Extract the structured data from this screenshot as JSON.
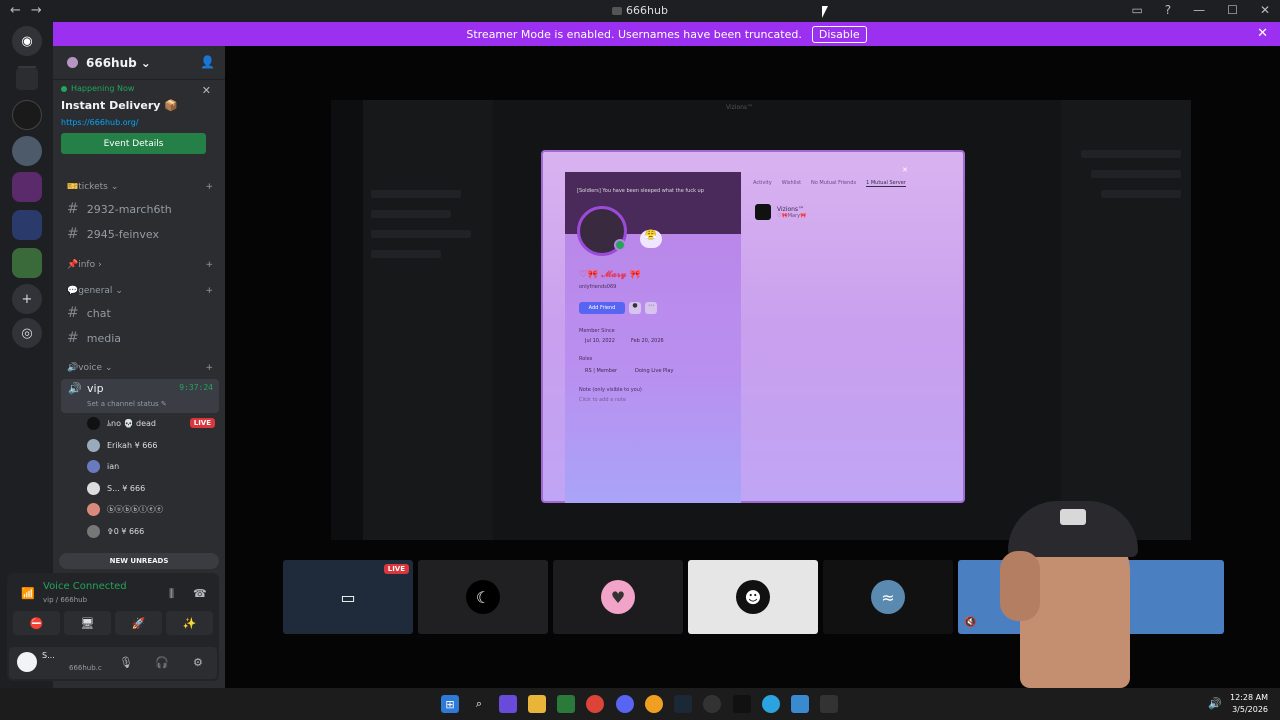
{
  "window": {
    "title": "666hub",
    "back_icon": "←",
    "forward_icon": "→",
    "inbox_icon": "▭",
    "help_icon": "?",
    "minimize": "—",
    "maximize": "☐",
    "close": "✕"
  },
  "banner": {
    "text": "Streamer Mode is enabled. Usernames have been truncated.",
    "button": "Disable",
    "close": "✕"
  },
  "server": {
    "name": "666hub",
    "chevron": "⌄"
  },
  "event": {
    "happening": "Happening Now",
    "title": "Instant Delivery 📦",
    "link": "https://666hub.org/",
    "button": "Event Details",
    "close": "✕"
  },
  "categories": {
    "tickets": "🎫tickets",
    "info": "📌info",
    "general": "💬general",
    "voice": "🔊voice",
    "plus": "+",
    "expand": "⌄",
    "collapsed": "›"
  },
  "channels": {
    "c1": "2932-march6th",
    "c2": "2945-feinvex",
    "c3": "chat",
    "c4": "media"
  },
  "voice_channel": {
    "name": "vip",
    "time": "9:37:24",
    "status": "Set a channel status ✎"
  },
  "voice_users": [
    {
      "name": "ﾑnо 💀 dead",
      "live": "LIVE"
    },
    {
      "name": "Erikah ¥ 666"
    },
    {
      "name": "ian"
    },
    {
      "name": "S... ¥ 666"
    },
    {
      "name": "ⓑⓤⓑⓑⓛⓔⓔ"
    },
    {
      "name": "✞0 ¥ 666"
    }
  ],
  "new_unreads": "NEW UNREADS",
  "voice_panel": {
    "title": "Voice Connected",
    "sub": "vip / 666hub",
    "sig_icon": "📶",
    "waveform_icon": "⫼",
    "hangup_icon": "☎",
    "btn1": "⛔",
    "btn2": "🖥",
    "btn3": "🚀",
    "btn4": "✨"
  },
  "user": {
    "name": "S...",
    "sub": "666hub.c",
    "mic": "🎙",
    "headphones": "🎧",
    "gear": "⚙"
  },
  "profile": {
    "note": "[Soldiers] You have been sleeped what the fuck up",
    "name": "♡🎀 𝓜𝓪𝓻𝔂 🎀",
    "handle": "onlyfriends069",
    "add_friend": "Add Friend",
    "member_since_label": "Member Since",
    "member_since_1": "Jul 10, 2022",
    "member_since_2": "Feb 20, 2026",
    "roles_label": "Roles",
    "role1": "RS | Member",
    "role2": "Doing Live Play",
    "note_label": "Note (only visible to you)",
    "note_placeholder": "Click to add a note",
    "tabs": [
      "Activity",
      "Wishlist",
      "No Mutual Friends",
      "1 Mutual Server"
    ],
    "mutual_name": "Vizions™",
    "mutual_sub": "♡🎀Mary🎀",
    "emoji": "😤"
  },
  "shared_screen_title": "Vizions™",
  "tiles": {
    "live": "LIVE",
    "t2_icon": "☾",
    "t4_icon": "☻",
    "mute_icon": "🔇"
  },
  "taskbar": {
    "time": "12:28 AM",
    "date": "3/5/2026",
    "volume": "🔊"
  },
  "colors": {
    "accent_purple": "#9b30f0",
    "voice_green": "#23a55a",
    "live_red": "#da373c",
    "blurple": "#5865f2"
  }
}
